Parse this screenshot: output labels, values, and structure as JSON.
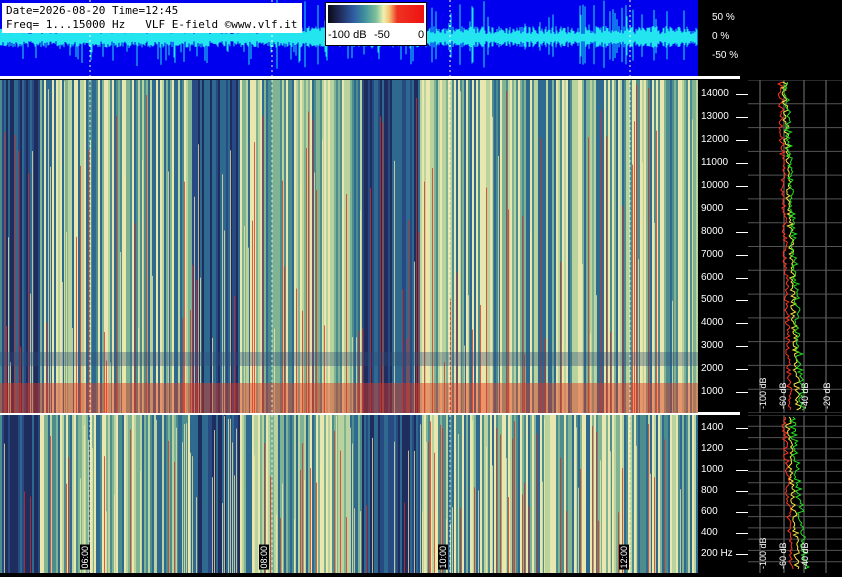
{
  "header": {
    "line1": "Date=2026-08-20 Time=12:45",
    "line2": "Freq= 1...15000 Hz",
    "credit": "VLF E-field ©www.vlf.it"
  },
  "colorbar": {
    "labels": [
      "-100 dB",
      "-50",
      "0"
    ],
    "colors": [
      "#0a0a14",
      "#2e5aa0",
      "#7cbf9a",
      "#f0f0b0",
      "#ee1111"
    ]
  },
  "waveform": {
    "labels": [
      "50 %",
      "0 %",
      "-50 %"
    ],
    "background": "#0000ee",
    "trace_color": "#22e5f0"
  },
  "spectrogram_main": {
    "freq_ticks": [
      "14000",
      "13000",
      "12000",
      "11000",
      "10000",
      "9000",
      "8000",
      "7000",
      "6000",
      "5000",
      "4000",
      "3000",
      "2000",
      "1000"
    ]
  },
  "spectrogram_low": {
    "freq_ticks": [
      "1400",
      "1200",
      "1000",
      "800",
      "600",
      "400",
      "200 Hz"
    ],
    "time_labels": [
      "06:00",
      "08:00",
      "10:00",
      "12:00"
    ]
  },
  "profile_main": {
    "db_labels": [
      "-100 dB",
      "-60 dB",
      "-40 dB",
      "-20 dB"
    ]
  },
  "profile_low": {
    "db_labels": [
      "-100 dB",
      "-60 dB",
      "-40 dB"
    ]
  }
}
